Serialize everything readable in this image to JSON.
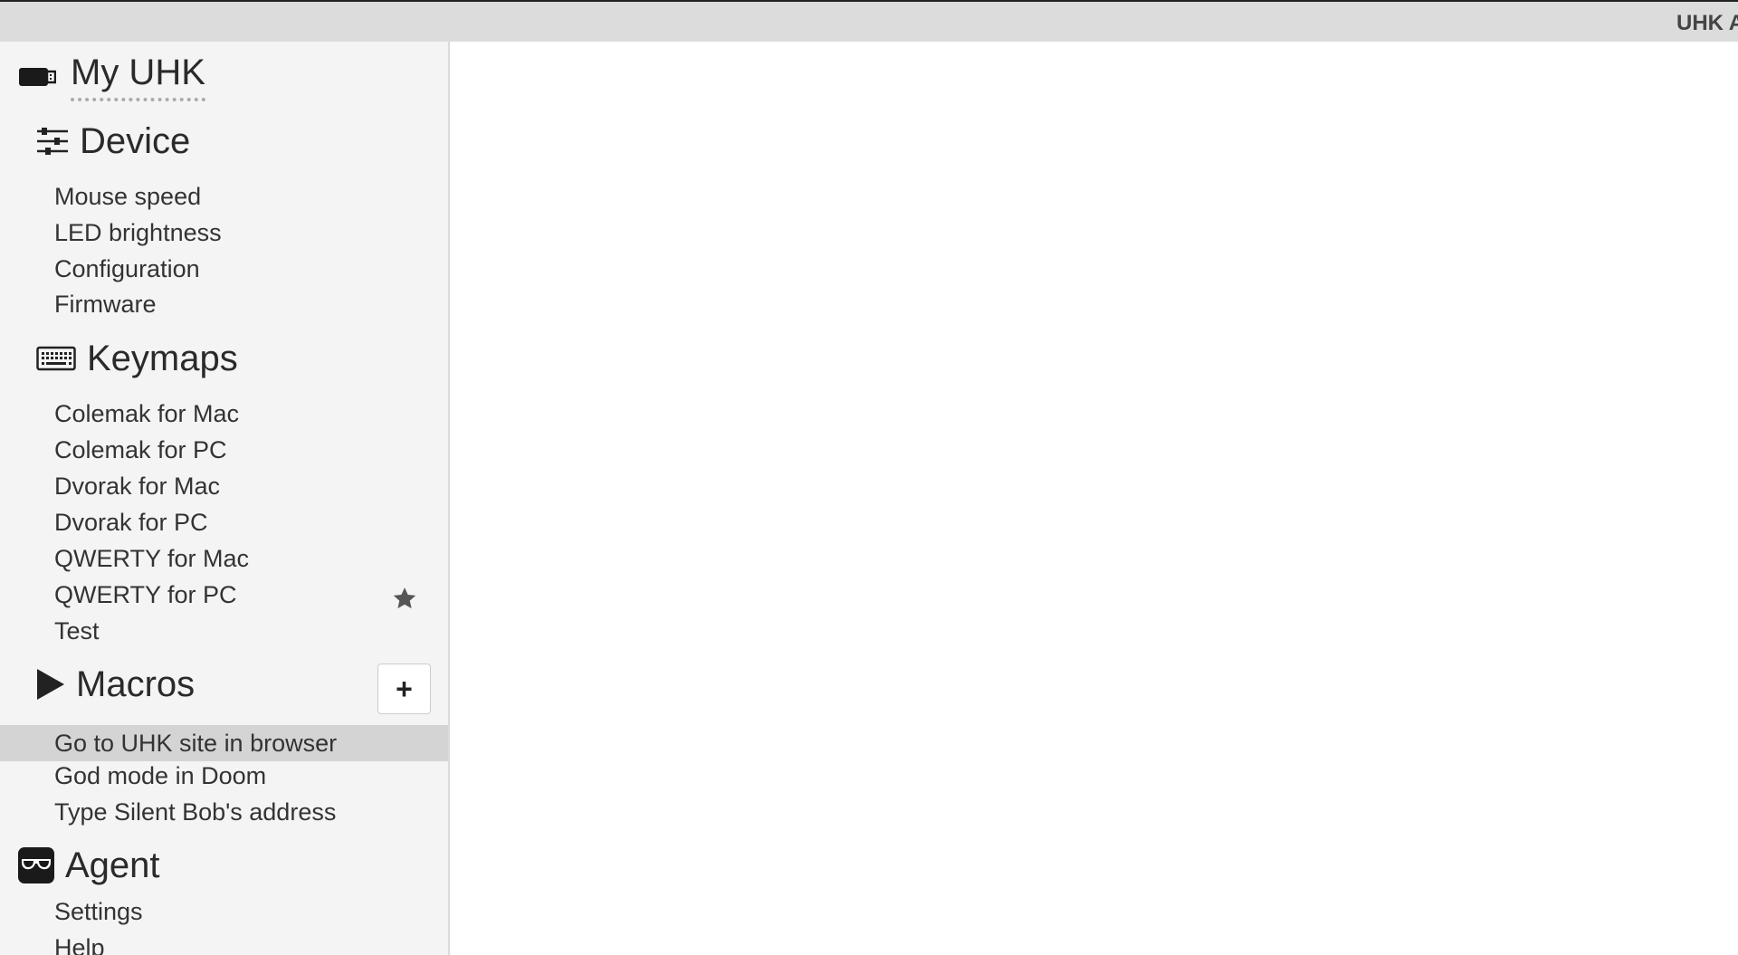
{
  "app": {
    "title": "UHK A"
  },
  "sidebar": {
    "my_uhk": {
      "label": "My UHK",
      "icon": "usb-drive-icon"
    },
    "device": {
      "label": "Device",
      "icon": "sliders-icon",
      "items": [
        {
          "label": "Mouse speed"
        },
        {
          "label": "LED brightness"
        },
        {
          "label": "Configuration"
        },
        {
          "label": "Firmware"
        }
      ]
    },
    "keymaps": {
      "label": "Keymaps",
      "icon": "keyboard-icon",
      "items": [
        {
          "label": "Colemak for Mac"
        },
        {
          "label": "Colemak for PC"
        },
        {
          "label": "Dvorak for Mac"
        },
        {
          "label": "Dvorak for PC"
        },
        {
          "label": "QWERTY for Mac"
        },
        {
          "label": "QWERTY for PC",
          "default": true
        },
        {
          "label": "Test"
        }
      ]
    },
    "macros": {
      "label": "Macros",
      "icon": "play-icon",
      "add_label": "+",
      "items": [
        {
          "label": "Go to UHK site in browser",
          "selected": true
        },
        {
          "label": "God mode in Doom"
        },
        {
          "label": "Type Silent Bob's address"
        }
      ]
    },
    "agent": {
      "label": "Agent",
      "icon": "sunglasses-icon",
      "items": [
        {
          "label": "Settings"
        },
        {
          "label": "Help"
        }
      ]
    }
  },
  "colors": {
    "topbar": "#dcdcdc",
    "sidebar": "#f4f4f4",
    "selected": "#d4d4d4",
    "text": "#2a2a2a"
  }
}
